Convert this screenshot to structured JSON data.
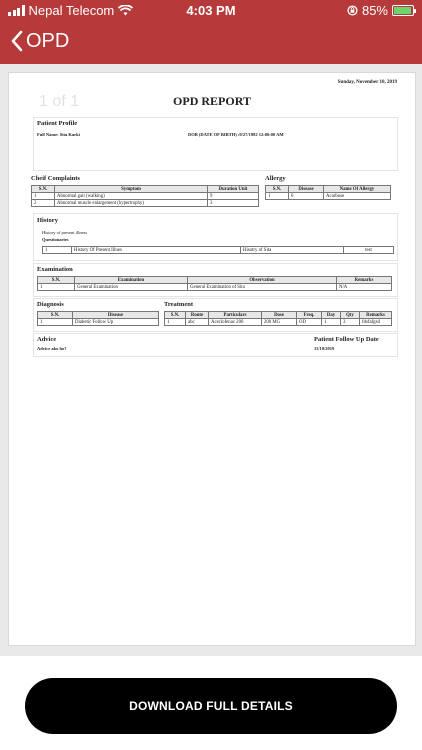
{
  "status_bar": {
    "carrier": "Nepal Telecom",
    "time": "4:03 PM",
    "battery": "85%"
  },
  "nav": {
    "back_label": "OPD"
  },
  "report": {
    "date": "Sunday, November 10, 2019",
    "page_counter": "1 of 1",
    "title": "OPD REPORT",
    "patient_profile": {
      "title": "Patient Profile",
      "full_name_label": "Full Name:",
      "full_name": "Sita Karki",
      "dob": "DOB (DATE OF BIRTH) :9/27/1982 12:00:00 AM"
    },
    "complaints": {
      "title": "Cheif Complaints",
      "headers": [
        "S.N.",
        "Symptom",
        "Duration Unit"
      ],
      "rows": [
        [
          "1",
          "Abnormal gait (walking)",
          "9"
        ],
        [
          "2",
          "Abnormal muscle enlargement (hypertrophy)",
          "3"
        ]
      ]
    },
    "allergy": {
      "title": "Allergy",
      "headers": [
        "S.N.",
        "Disease",
        "Name Of Allergy"
      ],
      "rows": [
        [
          "1",
          "0",
          "Acarbose"
        ]
      ]
    },
    "history": {
      "title": "History",
      "text": "History of present illness",
      "questionaries_label": "Questionaries",
      "rows": [
        [
          "1",
          "History Of Present Illnes",
          "Hisotry of Sita",
          "test"
        ]
      ]
    },
    "examination": {
      "title": "Examination",
      "headers": [
        "S.N.",
        "Examination",
        "Observation",
        "Remarks"
      ],
      "rows": [
        [
          "1",
          "General Examination",
          "General Examination of Sita",
          "N/A"
        ]
      ]
    },
    "diagnosis": {
      "title": "Diagnosis",
      "headers": [
        "S.N.",
        "Disease"
      ],
      "rows": [
        [
          "1",
          "Diabetic Follow Up"
        ]
      ]
    },
    "treatment": {
      "title": "Treatment",
      "headers": [
        "S.N.",
        "Route",
        "Particulars",
        "Dose",
        "Freq.",
        "Day",
        "Qty",
        "Remarks"
      ],
      "rows": [
        [
          "1",
          "abc",
          "Aceclofenac 200",
          "200 MG",
          "OD",
          "1",
          "3",
          "fdsfafgsd"
        ]
      ]
    },
    "advice": {
      "title": "Advice",
      "text": "Advice ako ho?"
    },
    "follow_up": {
      "title": "Patient Follow Up Date",
      "date": "11/10/2019"
    }
  },
  "download_button": {
    "label": "DOWNLOAD FULL DETAILS"
  },
  "colors": {
    "brand": "#b73a3a",
    "button": "#000000"
  }
}
